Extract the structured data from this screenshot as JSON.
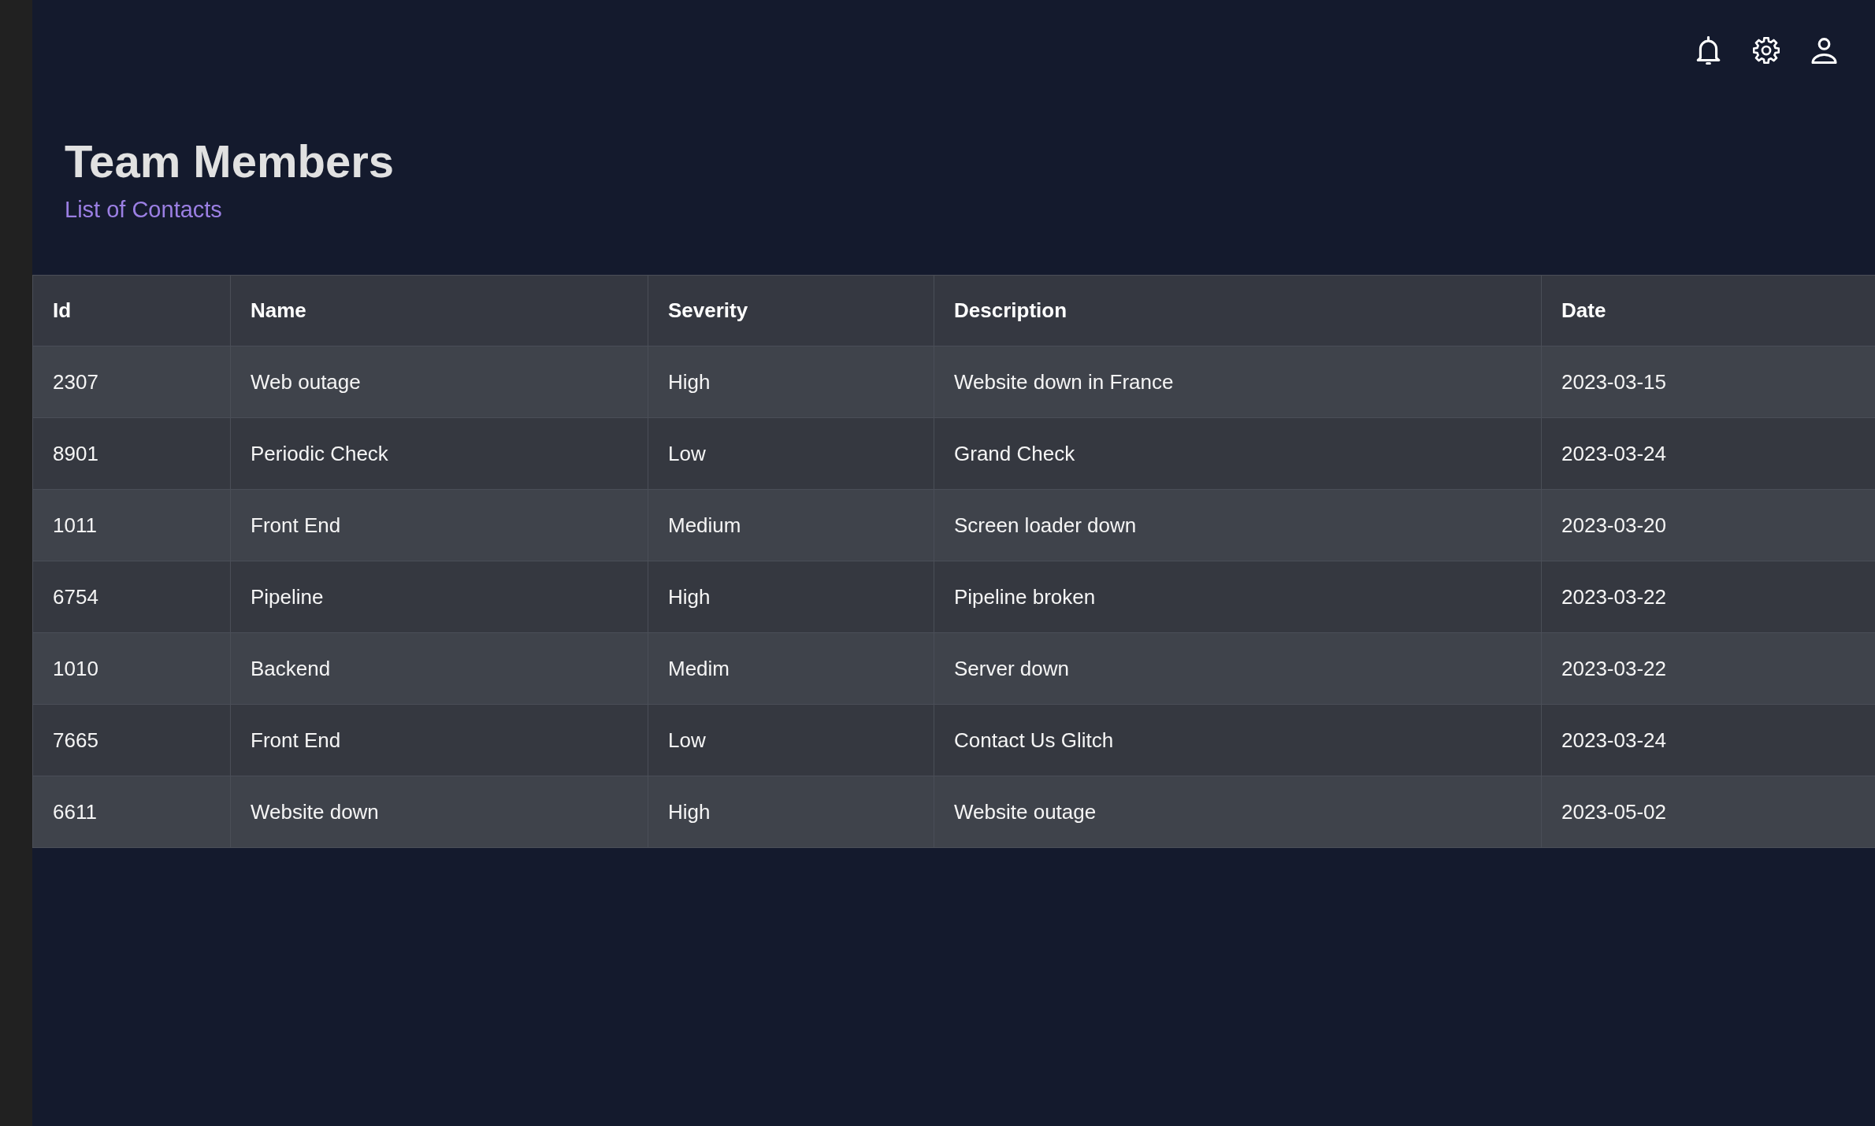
{
  "page": {
    "title": "Team Members",
    "subtitle": "List of Contacts"
  },
  "table": {
    "columns": [
      "Id",
      "Name",
      "Severity",
      "Description",
      "Date"
    ],
    "rows": [
      [
        "2307",
        "Web outage",
        "High",
        "Website down in France",
        "2023-03-15"
      ],
      [
        "8901",
        "Periodic Check",
        "Low",
        "Grand Check",
        "2023-03-24"
      ],
      [
        "1011",
        "Front End",
        "Medium",
        "Screen loader down",
        "2023-03-20"
      ],
      [
        "6754",
        "Pipeline",
        "High",
        "Pipeline broken",
        "2023-03-22"
      ],
      [
        "1010",
        "Backend",
        "Medim",
        "Server down",
        "2023-03-22"
      ],
      [
        "7665",
        "Front End",
        "Low",
        "Contact Us Glitch",
        "2023-03-24"
      ],
      [
        "6611",
        "Website down",
        "High",
        "Website outage",
        "2023-05-02"
      ]
    ]
  }
}
